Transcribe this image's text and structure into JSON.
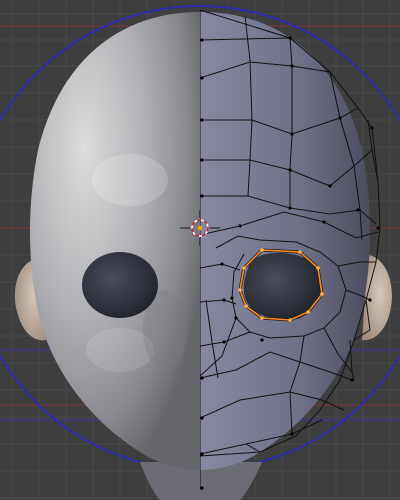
{
  "viewport": {
    "view": "front-orthographic",
    "mode": "edit-mode",
    "modifier": "mirror",
    "selection": "eye-loop"
  },
  "colors": {
    "background": "#3e3e3e",
    "grid": "#484848",
    "axis_x": "#9a3a3a",
    "circle": "#2b2ba8",
    "skin_light": "#d6d6d6",
    "skin_mid": "#a3a3a8",
    "skin_dark": "#5d5d66",
    "mirror_tint": "#6f7088",
    "ear": "#c9b8a8",
    "wire": "#101010",
    "selected_edge": "#ff8a1c",
    "cursor_red": "#e22222"
  }
}
